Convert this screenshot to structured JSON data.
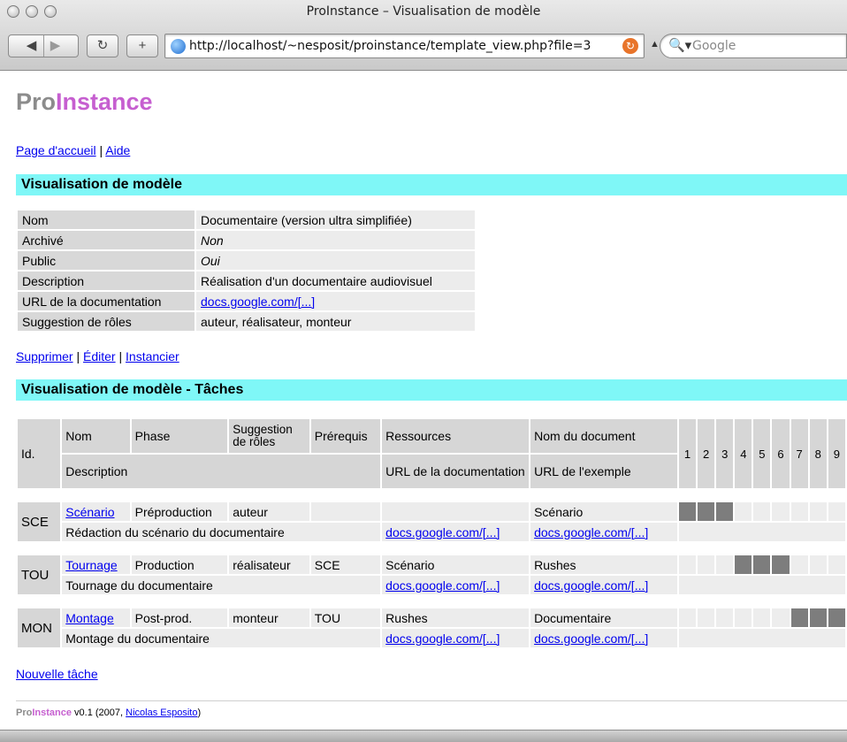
{
  "window": {
    "title": "ProInstance – Visualisation de modèle"
  },
  "toolbar": {
    "url": "http://localhost/~nesposit/proinstance/template_view.php?file=3",
    "search_placeholder": "Google"
  },
  "page": {
    "logo_pro": "Pro",
    "logo_instance": "Instance",
    "nav": {
      "home": "Page d'accueil",
      "sep": " | ",
      "help": "Aide"
    },
    "section1_title": "Visualisation de modèle",
    "details": {
      "nom_label": "Nom",
      "nom_value": "Documentaire (version ultra simplifiée)",
      "archive_label": "Archivé",
      "archive_value": "Non",
      "public_label": "Public",
      "public_value": "Oui",
      "description_label": "Description",
      "description_value": "Réalisation d'un documentaire audiovisuel",
      "url_label": "URL de la documentation",
      "url_value": "docs.google.com/[...]",
      "roles_label": "Suggestion de rôles",
      "roles_value": "auteur, réalisateur, monteur"
    },
    "actions": {
      "delete": "Supprimer",
      "edit": "Éditer",
      "instantiate": "Instancier",
      "sep": " | "
    },
    "section2_title": "Visualisation de modèle - Tâches",
    "task_headers": {
      "id": "Id.",
      "nom": "Nom",
      "phase": "Phase",
      "suggestion_roles": "Suggestion de rôles",
      "prerequis": "Prérequis",
      "ressources": "Ressources",
      "nom_document": "Nom du document",
      "description": "Description",
      "url_documentation": "URL de la documentation",
      "url_exemple": "URL de l'exemple",
      "columns": [
        "1",
        "2",
        "3",
        "4",
        "5",
        "6",
        "7",
        "8",
        "9"
      ]
    },
    "tasks": [
      {
        "id": "SCE",
        "nom": "Scénario",
        "phase": "Préproduction",
        "roles": "auteur",
        "prerequis": "",
        "ressources": "",
        "document": "Scénario",
        "description": "Rédaction du scénario du documentaire",
        "url_doc": "docs.google.com/[...]",
        "url_example": "docs.google.com/[...]"
      },
      {
        "id": "TOU",
        "nom": "Tournage",
        "phase": "Production",
        "roles": "réalisateur",
        "prerequis": "SCE",
        "ressources": "Scénario",
        "document": "Rushes",
        "description": "Tournage du documentaire",
        "url_doc": "docs.google.com/[...]",
        "url_example": "docs.google.com/[...]"
      },
      {
        "id": "MON",
        "nom": "Montage",
        "phase": "Post-prod.",
        "roles": "monteur",
        "prerequis": "TOU",
        "ressources": "Rushes",
        "document": "Documentaire",
        "description": "Montage du documentaire",
        "url_doc": "docs.google.com/[...]",
        "url_example": "docs.google.com/[...]"
      }
    ],
    "new_task": "Nouvelle tâche",
    "footer": {
      "pro": "Pro",
      "instance": "Instance",
      "version": " v0.1 (2007, ",
      "author": "Nicolas Esposito",
      "close": ")"
    }
  },
  "colors": {
    "section_bar": "#7ff7f7",
    "logo_instance": "#c65fd0",
    "logo_pro": "#8c8c8c",
    "timeline_filled": "#7d7d7d"
  }
}
